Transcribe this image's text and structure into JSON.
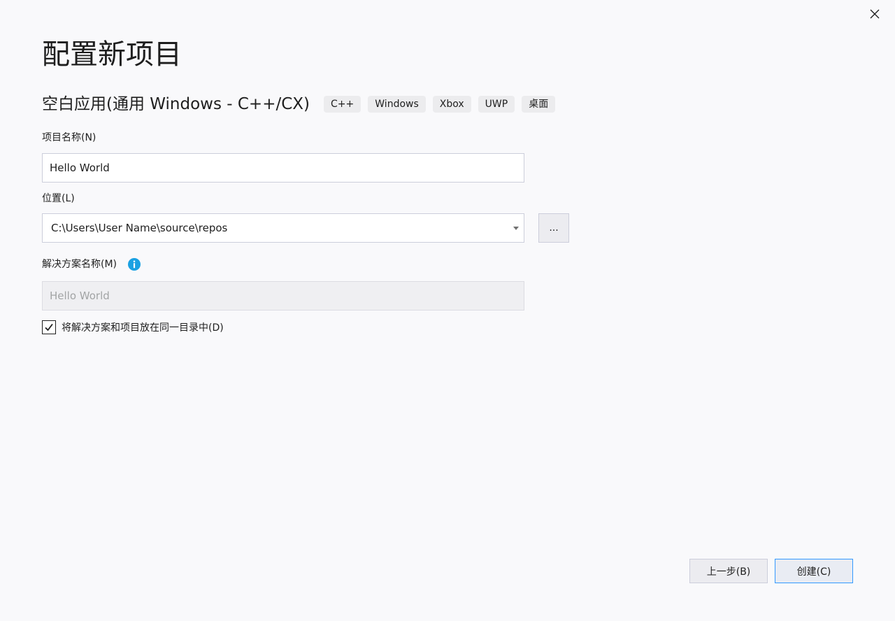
{
  "window": {
    "close_icon": "close-icon"
  },
  "header": {
    "title": "配置新项目",
    "template_name": "空白应用(通用 Windows - C++/CX)",
    "tags": [
      "C++",
      "Windows",
      "Xbox",
      "UWP",
      "桌面"
    ]
  },
  "form": {
    "project_name": {
      "label": "项目名称(N)",
      "value": "Hello World"
    },
    "location": {
      "label": "位置(L)",
      "value": "C:\\Users\\User Name\\source\\repos",
      "browse_label": "...",
      "dropdown_icon": "chevron-down-icon"
    },
    "solution_name": {
      "label": "解决方案名称(M)",
      "value": "Hello World",
      "disabled": true,
      "info_icon": "info-icon"
    },
    "same_directory": {
      "label": "将解决方案和项目放在同一目录中(D)",
      "checked": true
    }
  },
  "footer": {
    "back_label": "上一步(B)",
    "create_label": "创建(C)"
  },
  "colors": {
    "background": "#f9f9fb",
    "accent": "#3399ff",
    "info": "#1ba1e2",
    "tag_background": "#ececee"
  }
}
